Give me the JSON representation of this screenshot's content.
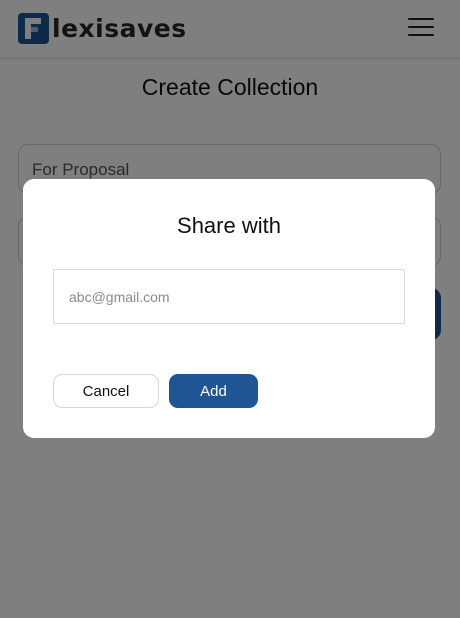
{
  "app": {
    "brand_letter": "F",
    "brand_rest": "lexisaves",
    "accent_color": "#1f5592"
  },
  "header": {
    "menu_icon": "hamburger-menu-icon"
  },
  "page": {
    "title": "Create Collection",
    "fields": [
      {
        "value": "For Proposal"
      },
      {
        "value": ""
      }
    ]
  },
  "modal": {
    "title": "Share with",
    "email_placeholder": "abc@gmail.com",
    "email_value": "",
    "cancel_label": "Cancel",
    "add_label": "Add"
  }
}
